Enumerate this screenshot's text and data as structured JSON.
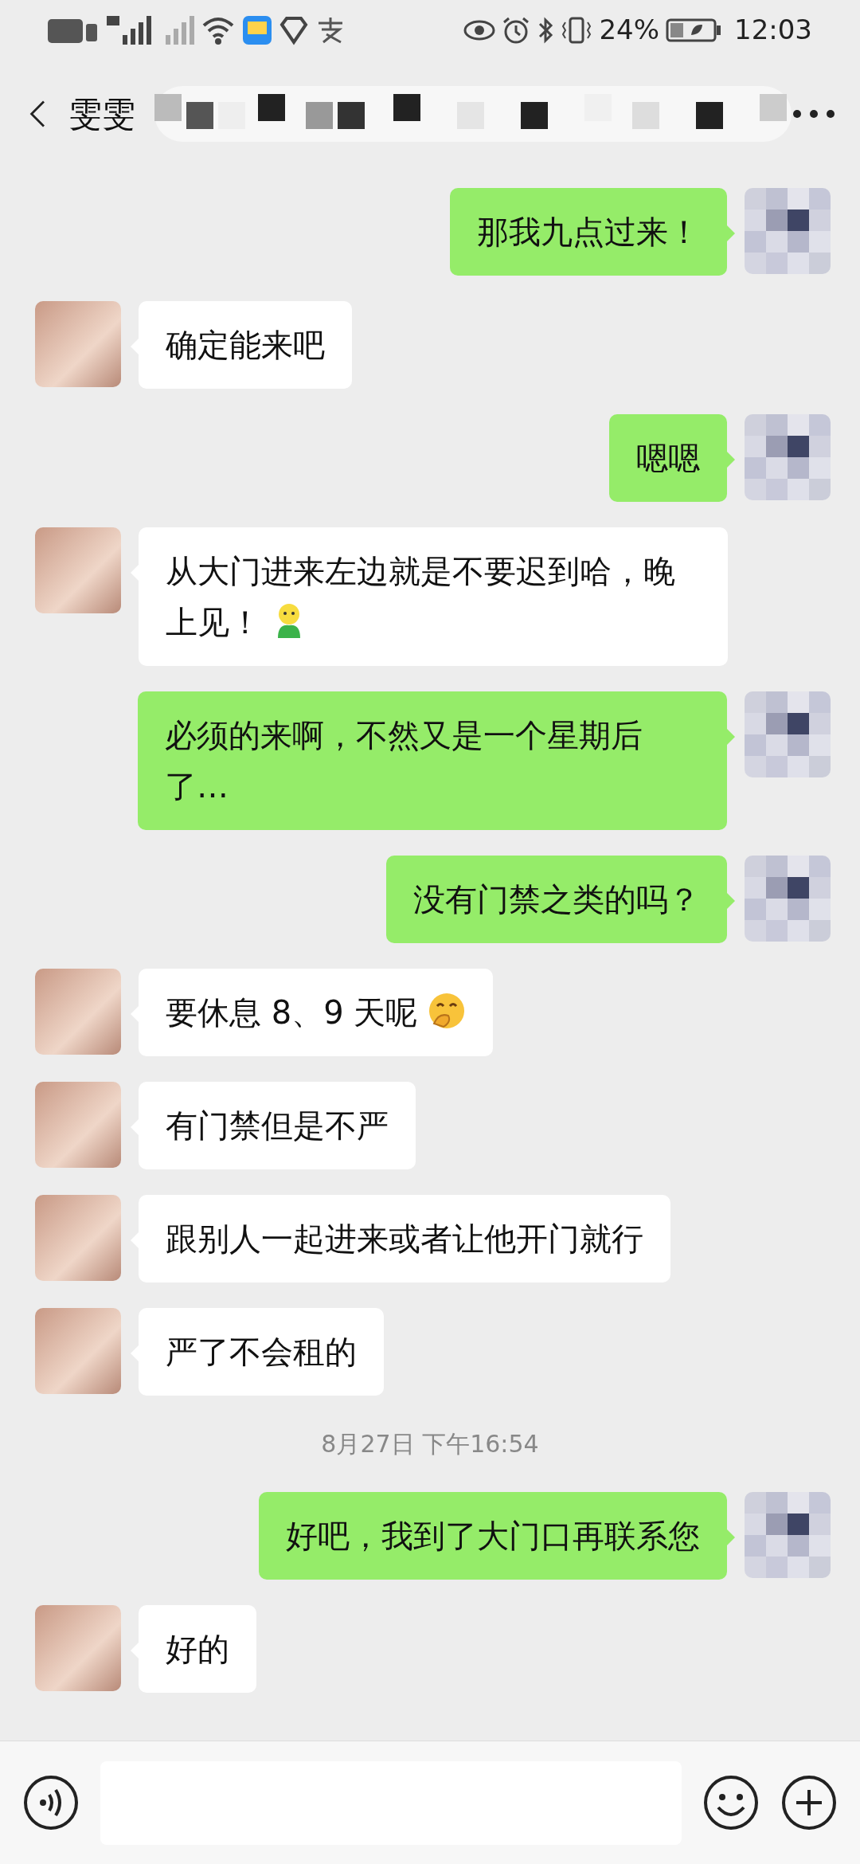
{
  "status_bar": {
    "battery_text": "24%",
    "time": "12:03"
  },
  "header": {
    "title": "雯雯"
  },
  "messages": [
    {
      "kind": "out",
      "text": "那我九点过来！"
    },
    {
      "kind": "in",
      "text": "确定能来吧"
    },
    {
      "kind": "out",
      "text": "嗯嗯"
    },
    {
      "kind": "in",
      "text": "从大门进来左边就是不要迟到哈，晚上见！",
      "figure_emoji": true
    },
    {
      "kind": "out",
      "text": "必须的来啊，不然又是一个星期后了…"
    },
    {
      "kind": "out",
      "text": "没有门禁之类的吗？"
    },
    {
      "kind": "in",
      "text": "要休息 8、9 天呢",
      "giggle_emoji": true
    },
    {
      "kind": "in",
      "text": "有门禁但是不严"
    },
    {
      "kind": "in",
      "text": "跟别人一起进来或者让他开门就行"
    },
    {
      "kind": "in",
      "text": "严了不会租的"
    },
    {
      "kind": "time",
      "text": "8月27日 下午16:54"
    },
    {
      "kind": "out",
      "text": "好吧，我到了大门口再联系您"
    },
    {
      "kind": "in",
      "text": "好的"
    }
  ]
}
